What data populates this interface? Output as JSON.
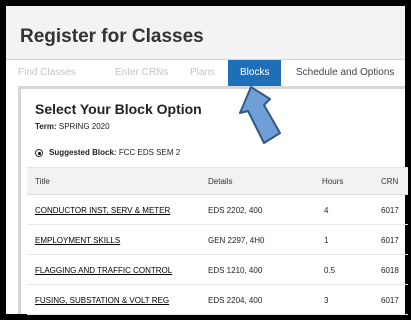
{
  "page": {
    "title": "Register for Classes"
  },
  "tabs": [
    {
      "label": "Find Classes"
    },
    {
      "label": "Enter CRNs"
    },
    {
      "label": "Plans"
    },
    {
      "label": "Blocks"
    },
    {
      "label": "Schedule and Options"
    }
  ],
  "panel": {
    "title": "Select Your Block Option",
    "term_label": "Term:",
    "term_value": "SPRING 2020",
    "suggested_label": "Suggested Block:",
    "suggested_value": "FCC EDS SEM 2"
  },
  "table": {
    "columns": [
      "Title",
      "Details",
      "Hours",
      "CRN"
    ],
    "rows": [
      {
        "title": "CONDUCTOR INST, SERV & METER",
        "details": "EDS 2202, 400",
        "hours": "4",
        "crn": "6017"
      },
      {
        "title": "EMPLOYMENT SKILLS",
        "details": "GEN 2297, 4H0",
        "hours": "1",
        "crn": "6017"
      },
      {
        "title": "FLAGGING AND TRAFFIC CONTROL",
        "details": "EDS 1210, 400",
        "hours": "0.5",
        "crn": "6018"
      },
      {
        "title": "FUSING, SUBSTATION & VOLT REG",
        "details": "EDS 2204, 400",
        "hours": "3",
        "crn": "6017"
      }
    ]
  },
  "colors": {
    "active_tab": "#1f6fb8",
    "arrow_fill": "#6f9fd6",
    "arrow_stroke": "#2f5a86"
  }
}
